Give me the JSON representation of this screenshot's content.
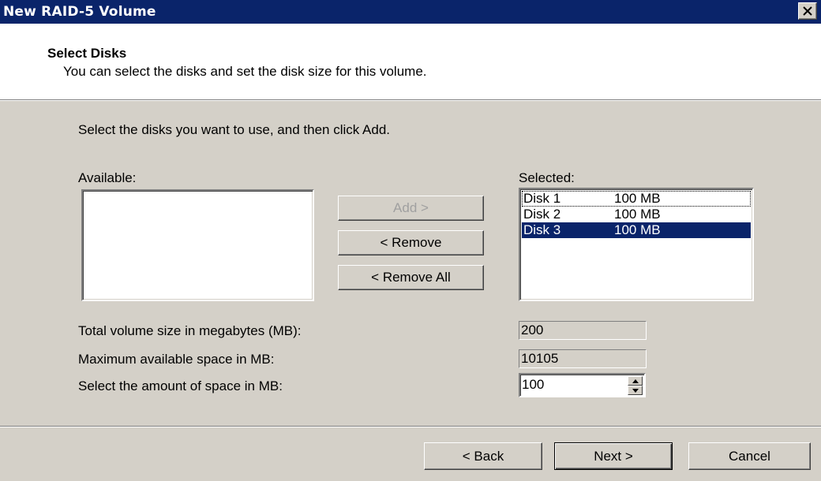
{
  "window": {
    "title": "New RAID-5 Volume",
    "close_icon": "close-x-icon"
  },
  "header": {
    "title": "Select Disks",
    "subtitle": "You can select the disks and set the disk size for this volume."
  },
  "instruction": "Select the disks you want to use, and then click Add.",
  "available": {
    "label": "Available:",
    "items": []
  },
  "selected": {
    "label": "Selected:",
    "items": [
      {
        "name": "Disk 1",
        "size": "100 MB"
      },
      {
        "name": "Disk 2",
        "size": "100 MB"
      },
      {
        "name": "Disk 3",
        "size": "100 MB"
      }
    ]
  },
  "buttons": {
    "add": "Add >",
    "remove": "< Remove",
    "remove_all": "< Remove All"
  },
  "fields": {
    "total_label": "Total volume size in megabytes (MB):",
    "total_value": "200",
    "max_label": "Maximum available space in MB:",
    "max_value": "10105",
    "amount_label": "Select the amount of space in MB:",
    "amount_value": "100"
  },
  "footer": {
    "back": "< Back",
    "next": "Next >",
    "cancel": "Cancel"
  },
  "colors": {
    "titlebar": "#0a246a",
    "face": "#d4d0c8",
    "selection": "#0a246a"
  }
}
